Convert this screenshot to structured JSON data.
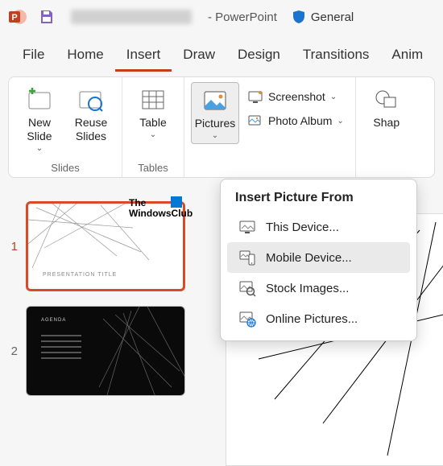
{
  "titlebar": {
    "app_name": "- PowerPoint",
    "sensitivity": "General"
  },
  "tabs": {
    "file": "File",
    "home": "Home",
    "insert": "Insert",
    "draw": "Draw",
    "design": "Design",
    "transitions": "Transitions",
    "animations": "Anim"
  },
  "ribbon": {
    "slides": {
      "label": "Slides",
      "new_slide": "New Slide",
      "reuse": "Reuse Slides"
    },
    "tables": {
      "label": "Tables",
      "table": "Table"
    },
    "images": {
      "pictures": "Pictures",
      "screenshot": "Screenshot",
      "photo_album": "Photo Album"
    },
    "illustrations": {
      "shapes": "Shap"
    }
  },
  "dropdown": {
    "header": "Insert Picture From",
    "this_device": "This Device...",
    "mobile_device": "Mobile Device...",
    "stock": "Stock Images...",
    "online": "Online Pictures..."
  },
  "thumbs": {
    "n1": "1",
    "n2": "2",
    "title1": "PRESENTATION TITLE",
    "title2": "AGENDA"
  },
  "watermark": {
    "line1": "The",
    "line2": "WindowsClub"
  }
}
